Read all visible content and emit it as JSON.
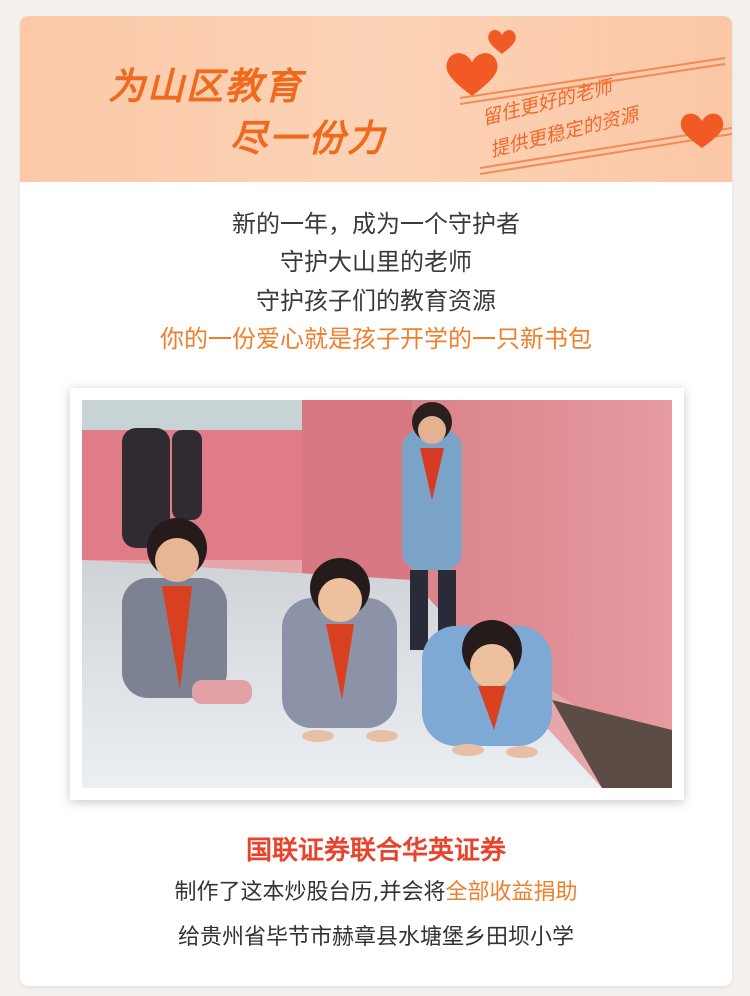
{
  "banner": {
    "slogan_line1": "为山区教育",
    "slogan_line2": "尽一份力",
    "note_line1": "留住更好的老师",
    "note_line2": "提供更稳定的资源",
    "colors": {
      "background": "#fcd0b2",
      "accent": "#f06a1d"
    },
    "icons": [
      "heart-icon",
      "heart-icon",
      "heart-icon"
    ]
  },
  "intro": {
    "line1": "新的一年，成为一个守护者",
    "line2": "守护大山里的老师",
    "line3": "守护孩子们的教育资源",
    "highlight": "你的一份爱心就是孩子开学的一只新书包"
  },
  "photo": {
    "subject": "children-in-school-hallway"
  },
  "footer": {
    "org": "国联证券联合华英证券",
    "line2_prefix": "制作了这本炒股台历,并会将",
    "line2_highlight": "全部收益捐助",
    "line3": "给贵州省毕节市赫章县水塘堡乡田坝小学",
    "colors": {
      "org": "#e8432c",
      "highlight": "#f07f2c"
    }
  }
}
